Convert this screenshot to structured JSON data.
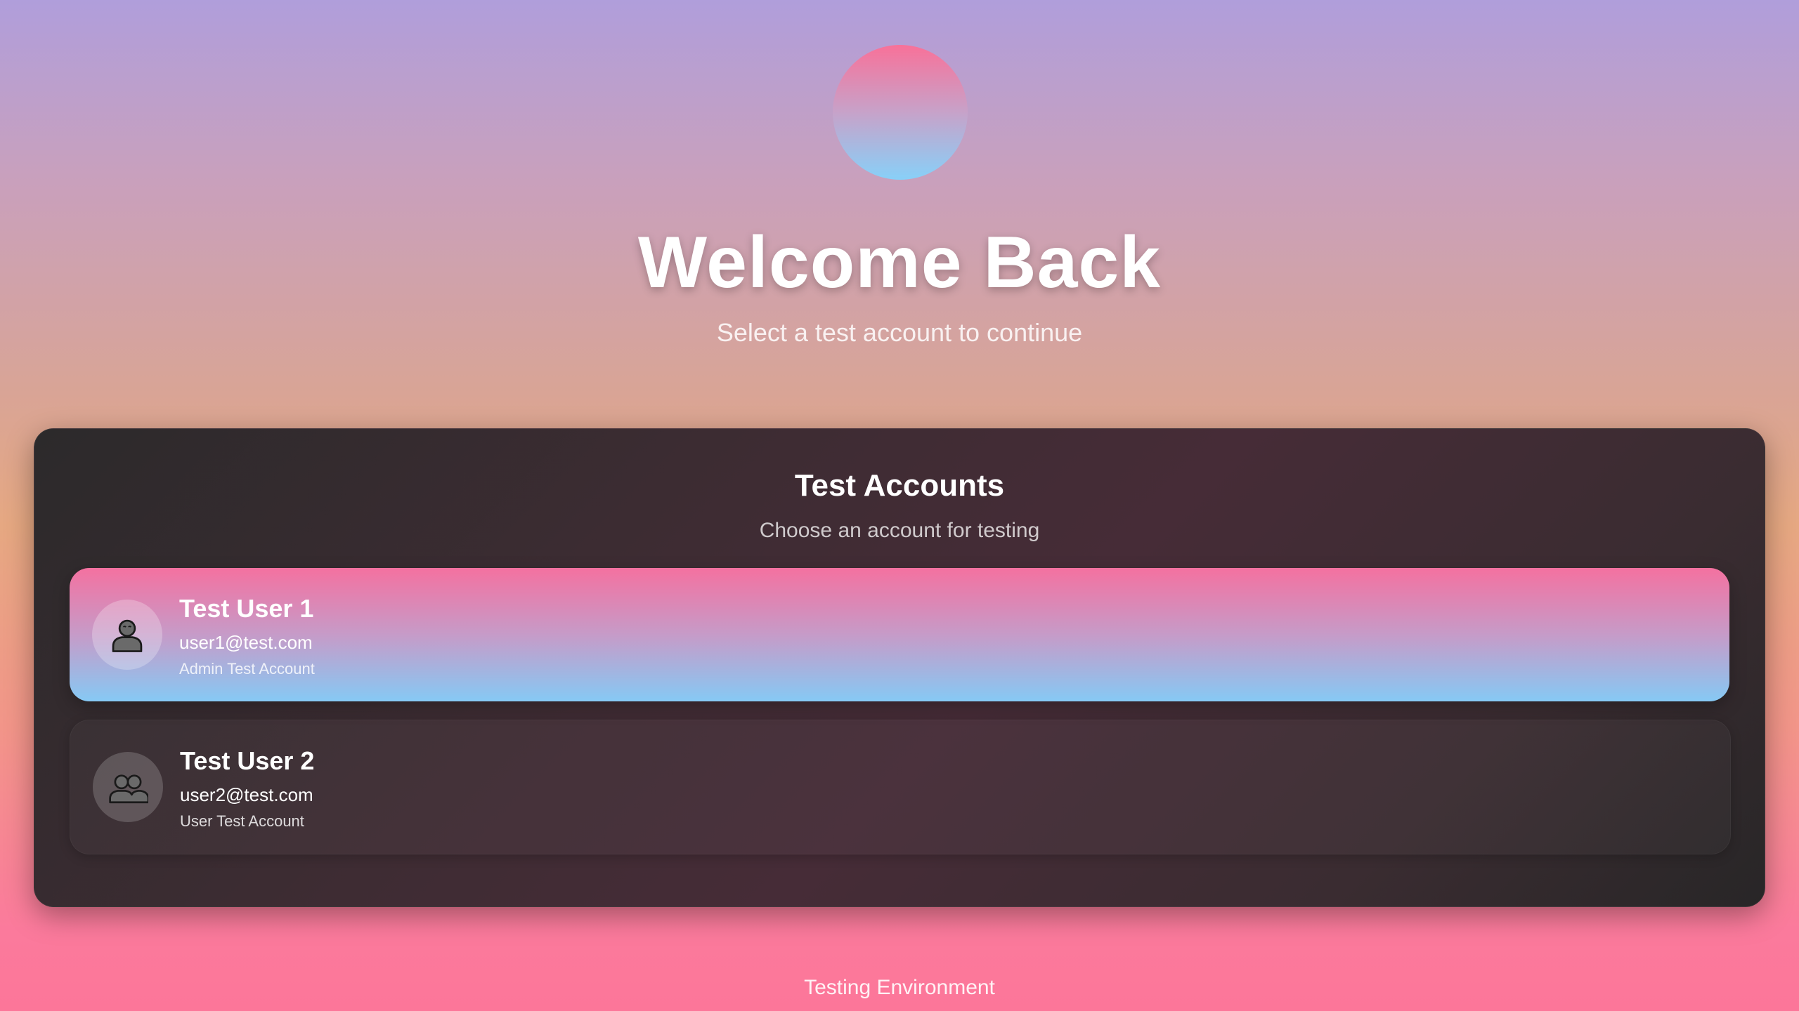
{
  "header": {
    "title": "Welcome Back",
    "subtitle": "Select a test account to continue"
  },
  "panel": {
    "title": "Test Accounts",
    "subtitle": "Choose an account for testing"
  },
  "accounts": [
    {
      "name": "Test User 1",
      "email": "user1@test.com",
      "role": "Admin Test Account",
      "icon": "person-icon",
      "selected": true
    },
    {
      "name": "Test User 2",
      "email": "user2@test.com",
      "role": "User Test Account",
      "icon": "people-icon",
      "selected": false
    }
  ],
  "footer": {
    "text": "Testing Environment"
  },
  "colors": {
    "accent_pink": "#f471a0",
    "accent_blue": "#86c9f4",
    "panel_dark": "#3e2c33"
  }
}
